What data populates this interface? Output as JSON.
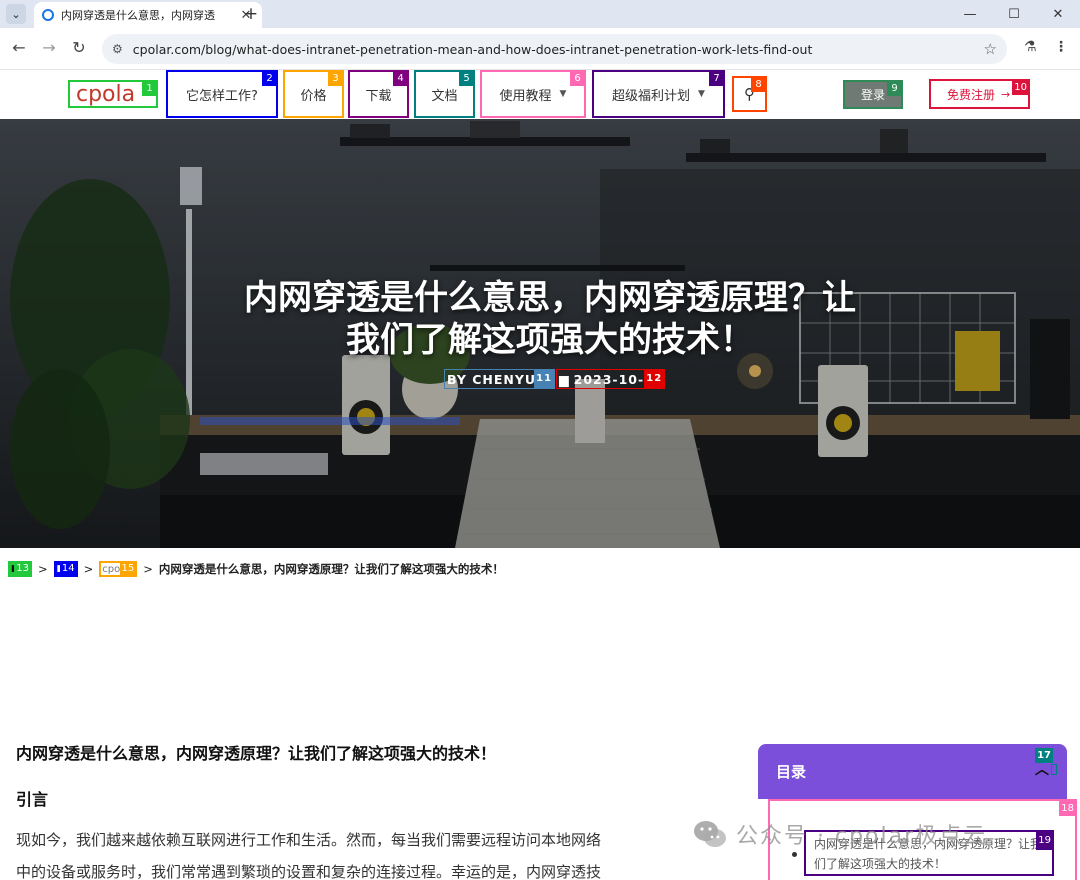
{
  "browser": {
    "tab_title": "内网穿透是什么意思，内网穿透",
    "tab_close": "✕",
    "new_tab": "+",
    "url": "cpolar.com/blog/what-does-intranet-penetration-mean-and-how-does-intranet-penetration-work-lets-find-out",
    "win_minimize": "—",
    "win_maximize": "☐",
    "win_close": "✕"
  },
  "header": {
    "logo": "cpola",
    "nav": {
      "how": "它怎样工作?",
      "price": "价格",
      "download": "下载",
      "docs": "文档",
      "tutorials": "使用教程",
      "welfare": "超级福利计划"
    },
    "login": "登录",
    "register": "免费注册",
    "marks": [
      "1",
      "2",
      "3",
      "4",
      "5",
      "6",
      "7",
      "8",
      "9",
      "10"
    ]
  },
  "hero": {
    "title": "内网穿透是什么意思，内网穿透原理？让我们了解这项强大的技术！",
    "author": "BY CHENYU",
    "date": "2023-10-",
    "marks": [
      "11",
      "12"
    ]
  },
  "breadcrumb": {
    "mark_13": "13",
    "mark_14": "14",
    "mark_15": "15",
    "item_3": "cpo",
    "separator": ">",
    "current": "内网穿透是什么意思，内网穿透原理？让我们了解这项强大的技术！"
  },
  "article": {
    "h1": "内网穿透是什么意思，内网穿透原理？让我们了解这项强大的技术！",
    "h2": "引言",
    "p1_line1": "现如今，我们越来越依赖互联网进行工作和生活。然而，每当我们需要远程访问本地网络",
    "p1_line2": "中的设备或服务时，我们常常遇到繁琐的设置和复杂的连接过程。幸运的是，内网穿透技"
  },
  "toc": {
    "title": "目录",
    "toggle": "^",
    "item_line1": "内网穿透是什么意思，内网穿透原理？让我",
    "item_line2": "们了解这项强大的技术！",
    "marks": [
      "17",
      "18",
      "19"
    ]
  },
  "watermark": {
    "text": "公众号 · cpolar极点云"
  },
  "colors": {
    "purple": "#7b4fd9",
    "mark_green": "#22c93a",
    "mark_blue": "#0000ee",
    "mark_orange": "#ffa500",
    "mark_purple": "#800080",
    "mark_teal": "#008080",
    "mark_pink": "#ff69b4",
    "mark_indigo": "#4b0082",
    "mark_orangered": "#ff4500",
    "mark_darkgreen": "#2e8b57",
    "mark_crimson": "#dc143c",
    "mark_steel": "#4682b4",
    "mark_red": "#e00000"
  }
}
